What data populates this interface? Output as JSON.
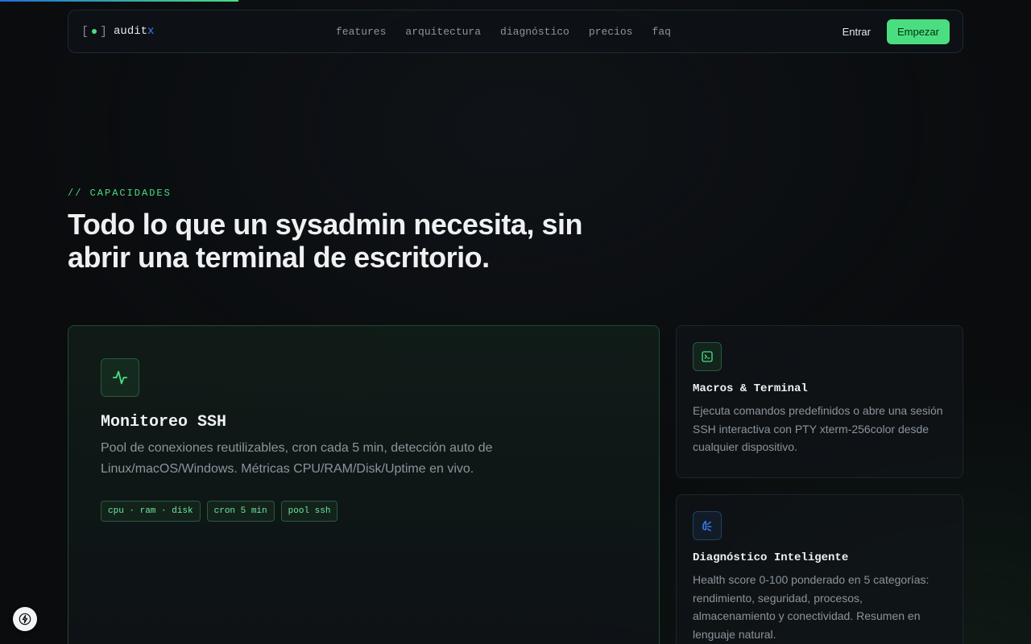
{
  "brand": {
    "bracket_open": "[",
    "bracket_close": "]",
    "name": "audit",
    "suffix": "x"
  },
  "nav": {
    "links": [
      "features",
      "arquitectura",
      "diagnóstico",
      "precios",
      "faq"
    ],
    "login": "Entrar",
    "start": "Empezar"
  },
  "section": {
    "eyebrow": "// CAPACIDADES",
    "headline": "Todo lo que un sysadmin necesita, sin abrir una terminal de escritorio."
  },
  "cards": {
    "main": {
      "icon": "activity-icon",
      "title": "Monitoreo SSH",
      "desc": "Pool de conexiones reutilizables, cron cada 5 min, detección auto de Linux/macOS/Windows. Métricas CPU/RAM/Disk/Uptime en vivo.",
      "tags": [
        "cpu · ram · disk",
        "cron 5 min",
        "pool ssh"
      ]
    },
    "macros": {
      "icon": "terminal-icon",
      "title": "Macros & Terminal",
      "desc": "Ejecuta comandos predefinidos o abre una sesión SSH interactiva con PTY xterm-256color desde cualquier dispositivo."
    },
    "diagnostic": {
      "icon": "brain-icon",
      "title": "Diagnóstico Inteligente",
      "desc": "Health score 0-100 ponderado en 5 categorías: rendimiento, seguridad, procesos, almacenamiento y conectividad. Resumen en lenguaje natural."
    }
  },
  "colors": {
    "accent": "#4ade80",
    "blue": "#3b82f6",
    "bg": "#0a0c0e"
  }
}
